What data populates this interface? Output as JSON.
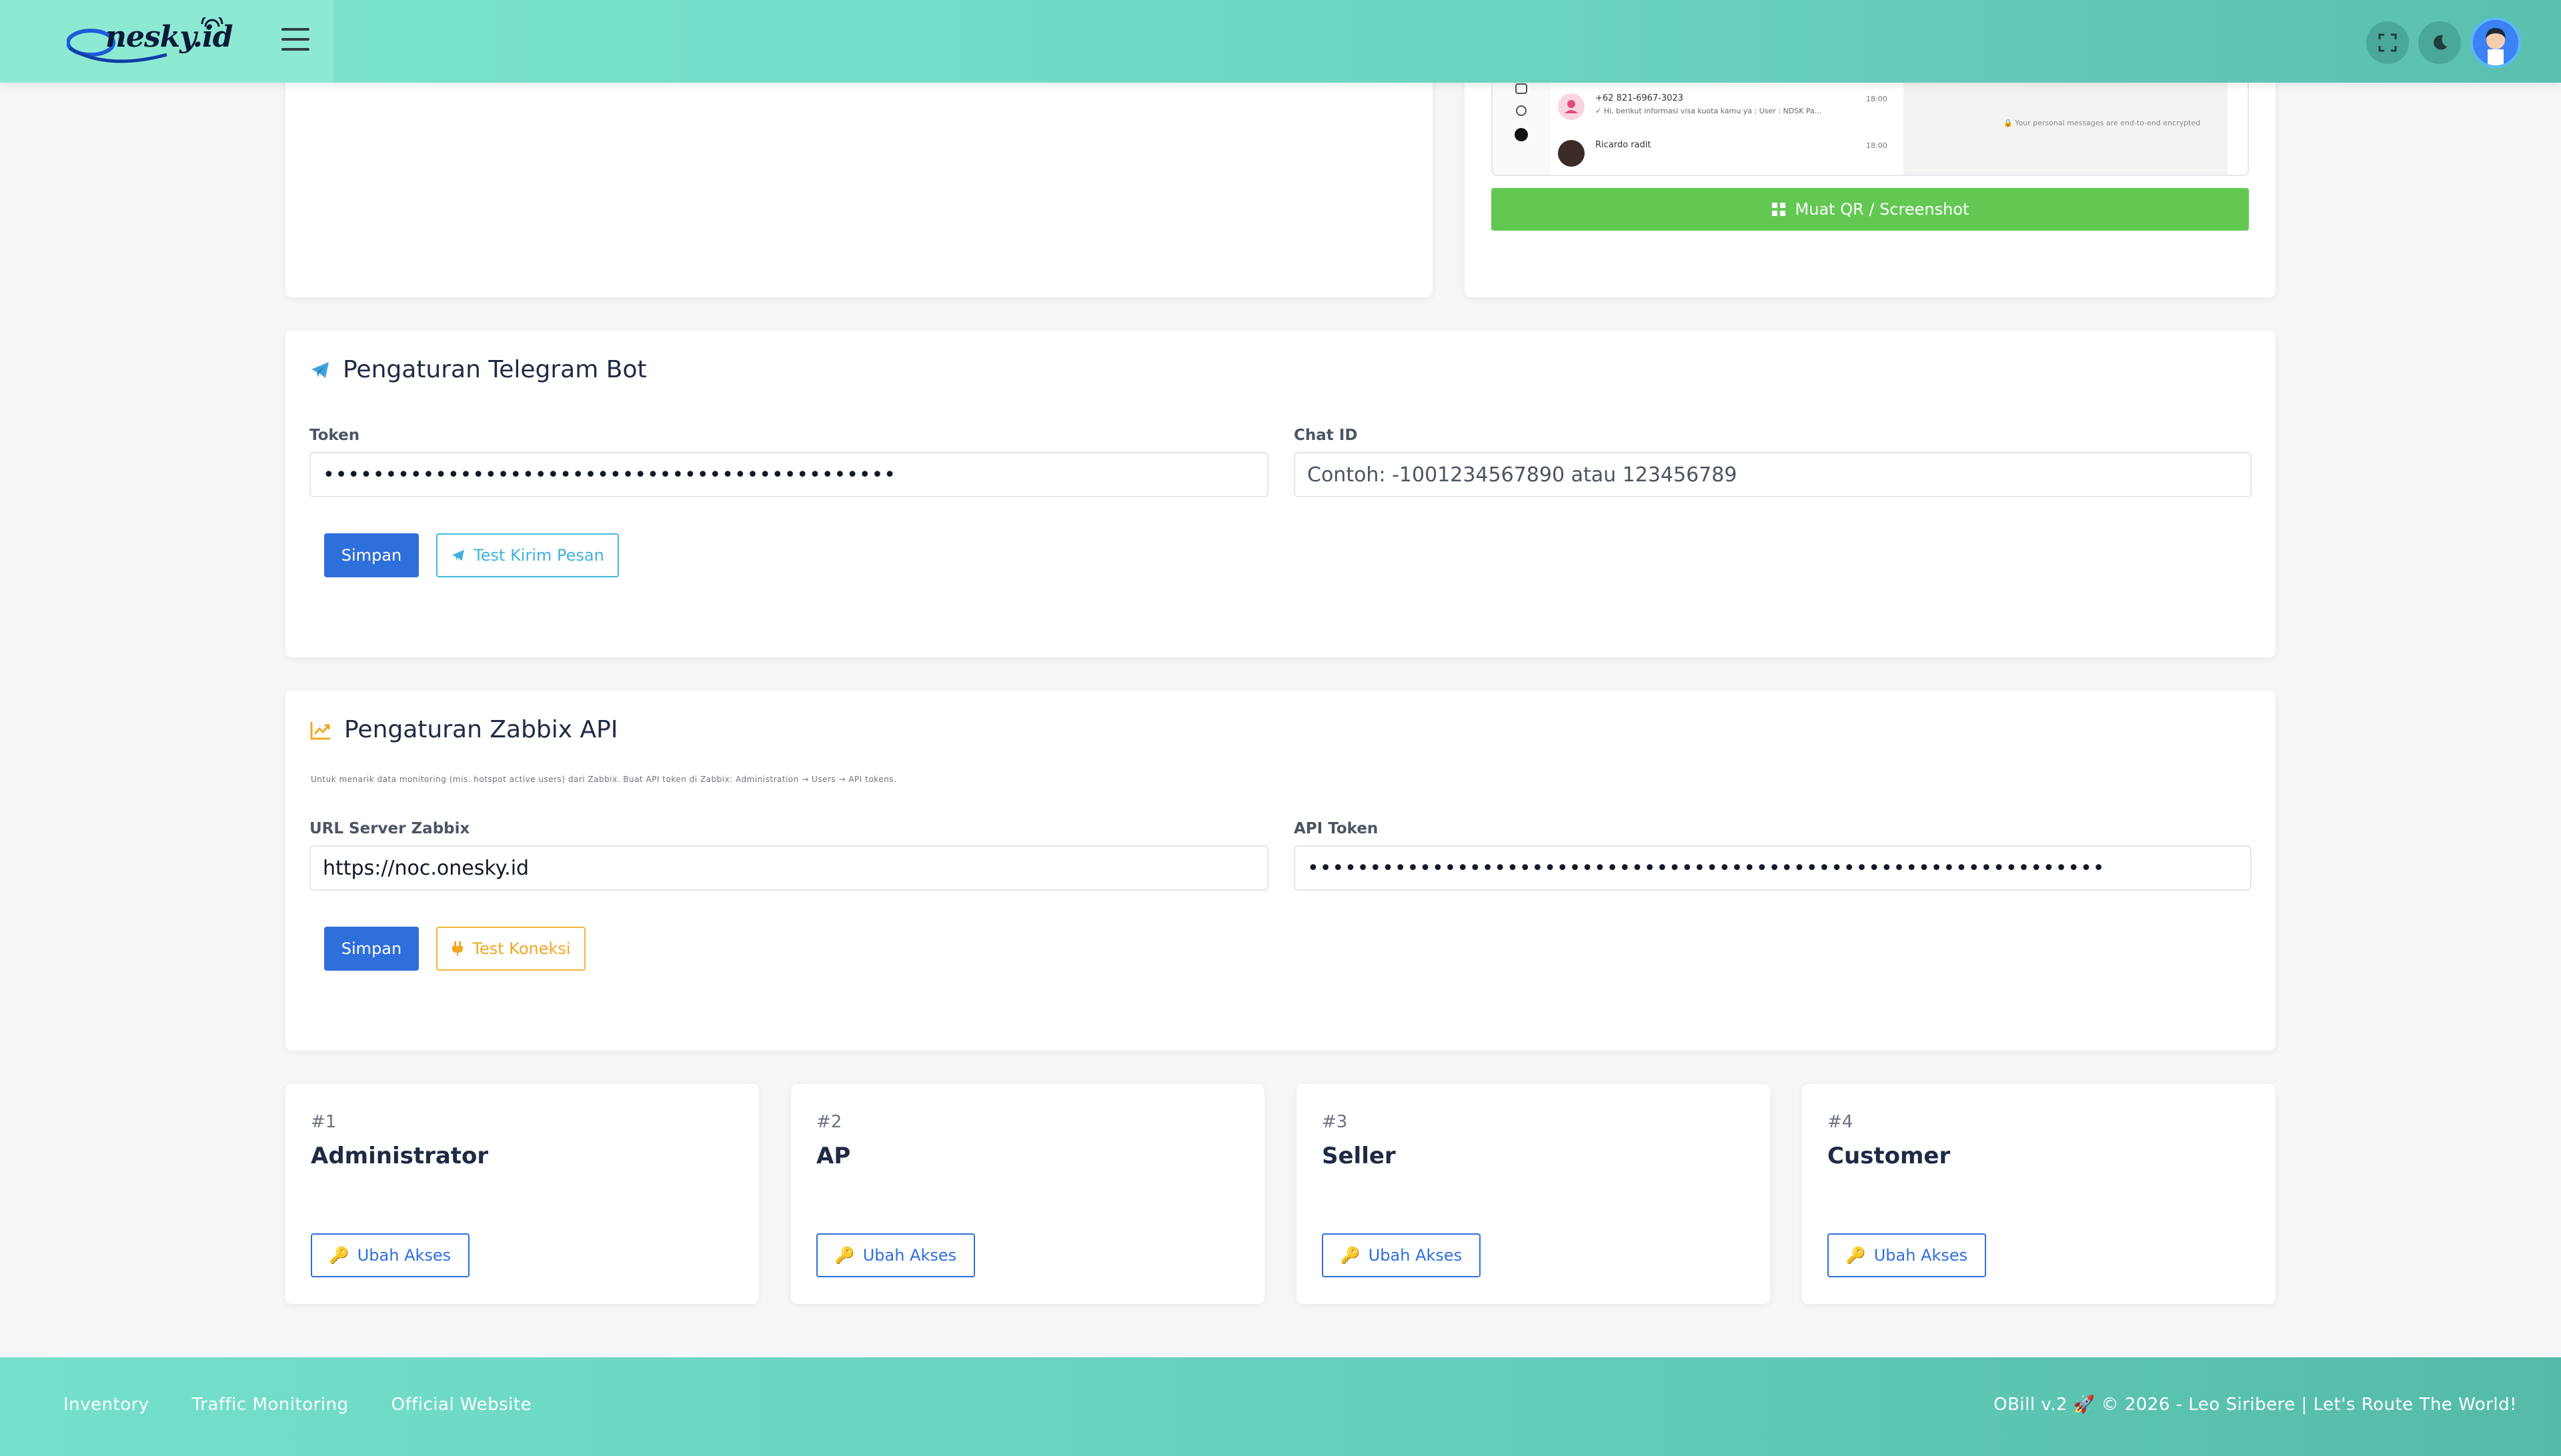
{
  "header": {
    "logo_text": "nesky.id",
    "icons": [
      "fullscreen-icon",
      "moon-icon",
      "avatar"
    ]
  },
  "whatsapp_preview": {
    "chat1_name": "+62 821-6967-3023",
    "chat1_time": "18:00",
    "chat1_msg": "✓ Hi, berikut informasi visa kuota kamu ya : User : NDSK Pa...",
    "chat2_name": "Ricardo radit",
    "chat2_time": "18:00",
    "encrypted_note": "Your personal messages are end-to-end encrypted",
    "load_button": "Muat QR / Screenshot"
  },
  "telegram": {
    "title": "Pengaturan Telegram Bot",
    "token_label": "Token",
    "token_value": "••••••••••••••••••••••••••••••••••••••••••••••",
    "chat_id_label": "Chat ID",
    "chat_id_placeholder": "Contoh: -1001234567890 atau 123456789",
    "save_label": "Simpan",
    "test_label": "Test Kirim Pesan"
  },
  "zabbix": {
    "title": "Pengaturan Zabbix API",
    "note": "Untuk menarik data monitoring (mis. hotspot active users) dari Zabbix. Buat API token di Zabbix: Administration → Users → API tokens.",
    "url_label": "URL Server Zabbix",
    "url_value": "https://noc.onesky.id",
    "token_label": "API Token",
    "token_value": "••••••••••••••••••••••••••••••••••••••••••••••••••••••••••••••••",
    "save_label": "Simpan",
    "test_label": "Test Koneksi"
  },
  "roles": [
    {
      "num": "#1",
      "name": "Administrator",
      "button": "Ubah Akses"
    },
    {
      "num": "#2",
      "name": "AP",
      "button": "Ubah Akses"
    },
    {
      "num": "#3",
      "name": "Seller",
      "button": "Ubah Akses"
    },
    {
      "num": "#4",
      "name": "Customer",
      "button": "Ubah Akses"
    }
  ],
  "footer": {
    "links": [
      "Inventory",
      "Traffic Monitoring",
      "Official Website"
    ],
    "copyright": "OBill v.2 🚀 © 2026 - Leo Siribere | Let's Route The World!"
  },
  "colors": {
    "primary": "#2f6fdb",
    "teal_header": "#6ed8c4",
    "green_button": "#62c852",
    "warning": "#f1a724",
    "info": "#3fb3d9"
  }
}
